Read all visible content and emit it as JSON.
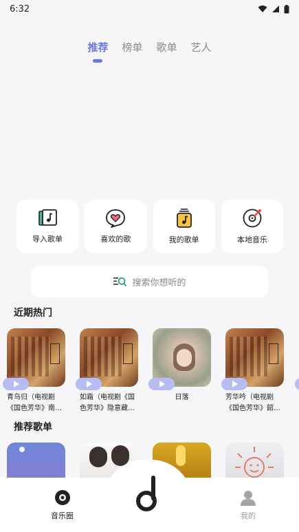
{
  "status": {
    "time": "6:32"
  },
  "tabs": [
    {
      "label": "推荐",
      "active": true
    },
    {
      "label": "榜单",
      "active": false
    },
    {
      "label": "歌单",
      "active": false
    },
    {
      "label": "艺人",
      "active": false
    }
  ],
  "quick_actions": [
    {
      "label": "导入歌单",
      "icon": "import-playlist-icon"
    },
    {
      "label": "喜欢的歌",
      "icon": "heart-chat-icon"
    },
    {
      "label": "我的歌单",
      "icon": "my-playlist-icon"
    },
    {
      "label": "本地音乐",
      "icon": "local-music-icon"
    }
  ],
  "search": {
    "placeholder": "搜索你想听的"
  },
  "recent_hot": {
    "title": "近期热门",
    "items": [
      {
        "title": "青鸟归（电视剧《国色芳华》南…"
      },
      {
        "title": "如霜（电视剧《国色芳华》隐意藏…"
      },
      {
        "title": "日落"
      },
      {
        "title": "芳华吟（电视剧《国色芳华》韶…"
      }
    ]
  },
  "recommended": {
    "title": "推荐歌单"
  },
  "bottom_nav": {
    "items": [
      {
        "label": "音乐圈"
      },
      {
        "label": "我的"
      }
    ]
  },
  "colors": {
    "accent": "#6b77e0",
    "play": "#b8bcf2"
  }
}
